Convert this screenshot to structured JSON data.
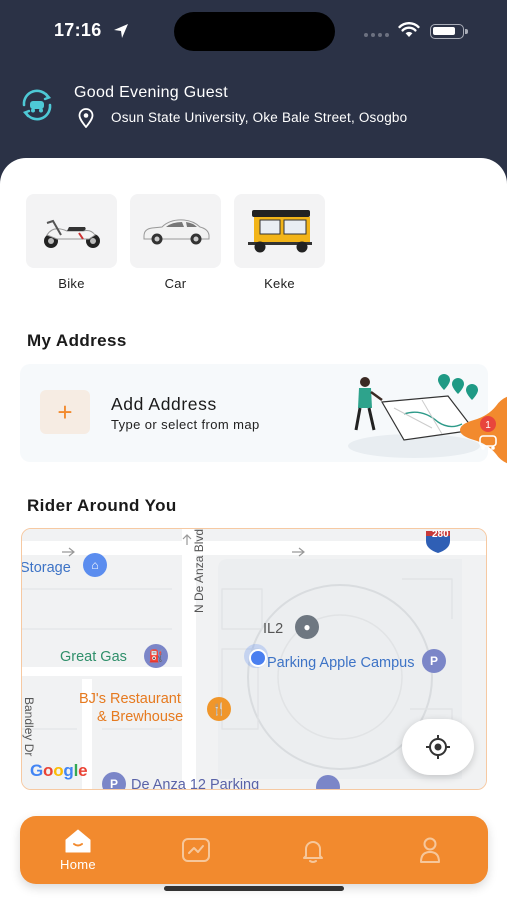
{
  "status_bar": {
    "time": "17:16"
  },
  "header": {
    "greeting": "Good Evening Guest",
    "location": "Osun State University, Oke Bale Street, Osogbo"
  },
  "ride_types": [
    {
      "label": "Bike",
      "icon": "motorbike-icon"
    },
    {
      "label": "Car",
      "icon": "car-icon"
    },
    {
      "label": "Keke",
      "icon": "keke-icon"
    }
  ],
  "address": {
    "section_title": "My Address",
    "add_title": "Add Address",
    "add_subtitle": "Type or select from map",
    "notification_badge": "1"
  },
  "riders": {
    "section_title": "Rider Around You",
    "map_labels": {
      "storage": "Storage",
      "street": "N De Anza Blvd",
      "il2": "IL2",
      "great_gas": "Great Gas",
      "campus": "Parking Apple Campus",
      "restaurant_line1": "BJ's Restaurant",
      "restaurant_line2": "& Brewhouse",
      "bandley": "Bandley Dr",
      "parking": "De Anza 12 Parking",
      "highway": "280",
      "google": "Google"
    }
  },
  "bottom_nav": {
    "items": [
      {
        "label": "Home",
        "icon": "home-icon",
        "active": true
      },
      {
        "label": "",
        "icon": "activity-chart-icon",
        "active": false
      },
      {
        "label": "",
        "icon": "bell-icon",
        "active": false
      },
      {
        "label": "",
        "icon": "profile-icon",
        "active": false
      }
    ]
  },
  "colors": {
    "header_bg": "#2b3246",
    "accent": "#f28a2e",
    "card_bg": "#f3f3f4"
  }
}
